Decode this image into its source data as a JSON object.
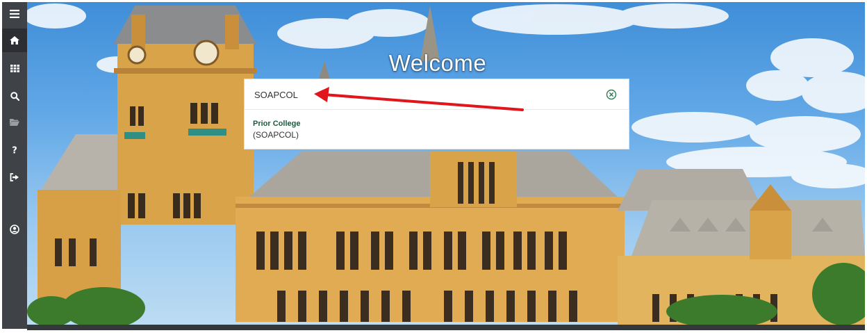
{
  "page": {
    "welcome_title": "Welcome"
  },
  "search": {
    "value": "SOAPCOL",
    "clear_icon": "circle-x-icon"
  },
  "results": [
    {
      "title": "Prior College",
      "code": "(SOAPCOL)"
    }
  ],
  "sidebar": {
    "items": [
      {
        "name": "menu",
        "icon": "hamburger-icon"
      },
      {
        "name": "home",
        "icon": "home-icon",
        "active": true
      },
      {
        "name": "applications",
        "icon": "grid-icon"
      },
      {
        "name": "search",
        "icon": "search-icon"
      },
      {
        "name": "recent",
        "icon": "folder-icon"
      },
      {
        "name": "help",
        "icon": "question-icon"
      },
      {
        "name": "sign-out",
        "icon": "sign-out-icon"
      },
      {
        "name": "user",
        "icon": "user-circle-icon"
      }
    ]
  },
  "colors": {
    "sidebar_bg": "#3f4246",
    "result_title": "#1d5a3d",
    "annotation_arrow": "#e0161b",
    "clear_icon": "#2e7d55"
  }
}
